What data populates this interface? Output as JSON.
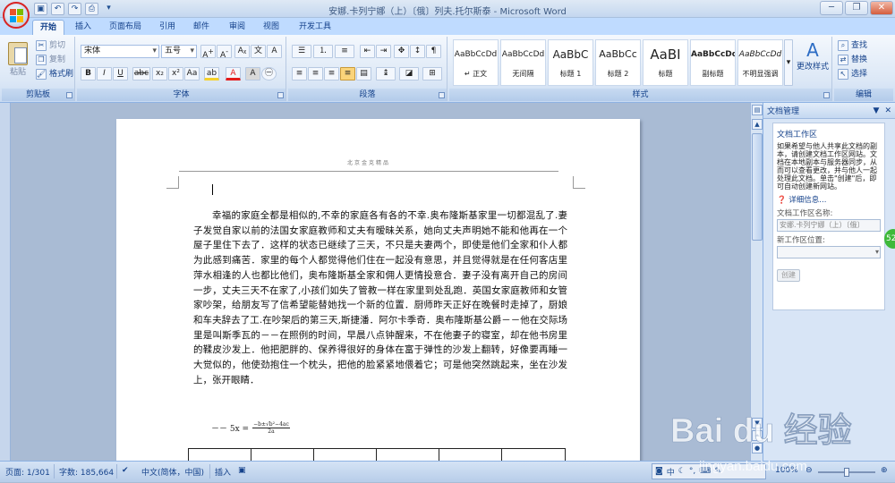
{
  "window": {
    "title": "安娜.卡列宁娜（上）〔俄〕列夫.托尔斯泰 - Microsoft Word",
    "qat": [
      "save-icon",
      "undo-icon",
      "redo-icon",
      "print-preview-icon"
    ]
  },
  "tabs": [
    "开始",
    "插入",
    "页面布局",
    "引用",
    "邮件",
    "审阅",
    "视图",
    "开发工具"
  ],
  "ribbon": {
    "clipboard": {
      "label": "剪贴板",
      "paste": "粘贴",
      "cut": "剪切",
      "copy": "复制",
      "format_painter": "格式刷"
    },
    "font": {
      "label": "字体",
      "font_name": "宋体",
      "font_size": "五号"
    },
    "paragraph": {
      "label": "段落"
    },
    "styles": {
      "label": "样式",
      "items": [
        {
          "sample": "AaBbCcDd",
          "name": "↵ 正文"
        },
        {
          "sample": "AaBbCcDd",
          "name": "无间隔"
        },
        {
          "sample": "AaBbC",
          "name": "标题 1"
        },
        {
          "sample": "AaBbCc",
          "name": "标题 2"
        },
        {
          "sample": "AaBI",
          "name": "标题"
        },
        {
          "sample": "AaBbCcDd",
          "name": "副标题"
        },
        {
          "sample": "AaBbCcDd",
          "name": "不明显强调"
        }
      ],
      "change_styles": "更改样式"
    },
    "editing": {
      "label": "编辑",
      "find": "查找",
      "replace": "替换",
      "select": "选择"
    }
  },
  "document": {
    "header_text": "北京金克精品",
    "body": "幸福的家庭全都是相似的,不幸的家庭各有各的不幸.奥布隆斯基家里一切都混乱了.妻子发觉自家以前的法国女家庭教师和丈夫有暧昧关系，她向丈夫声明她不能和他再在一个屋子里住下去了．这样的状态已继续了三天，不只是夫妻两个，即使是他们全家和仆人都为此感到痛苦．家里的每个人都觉得他们住在一起没有意思，并且觉得就是在任何客店里萍水相逢的人也都比他们，奥布隆斯基全家和佣人更情投意合．妻子没有离开自己的房间一步，丈夫三天不在家了,小孩们如失了管教一样在家里到处乱跑．英国女家庭教师和女管家吵架，给朋友写了信希望能替她找一个新的位置．厨师昨天正好在晚餐时走掉了，厨娘和车夫辞去了工.在吵架后的第三天,斯捷潘．阿尔卡季奇．奥布隆斯基公爵－－他在交际场里是叫斯季瓦的－－在照例的时间，早晨八点钟醒来，不在他妻子的寝室，却在他书房里的鞣皮沙发上．他把肥胖的、保养得很好的身体在富于弹性的沙发上翻转，好像要再睡一大觉似的，他使劲抱住一个枕头，把他的脸紧紧地偎着它；可是他突然跳起来，坐在沙发上，张开眼睛．",
    "formula_prefix": "－－  5x =",
    "formula_num": "−b±√b²−4ac",
    "formula_den": "2a"
  },
  "pane": {
    "title": "文档管理",
    "section": "文档工作区",
    "description": "如果希望与他人共享此文档的副本，请创建文档工作区网站。文档在本地副本与服务器同步，从而可以查看更改，并与他人一起处理此文档。单击\"创建\"后，即可自动创建新网站。",
    "info_link": "详细信息...",
    "name_label": "文档工作区名称:",
    "name_value": "安娜.卡列宁娜（上）〔俄〕",
    "location_label": "新工作区位置:",
    "create_label": "创建"
  },
  "status": {
    "page": "页面: 1/301",
    "words": "字数: 185,664",
    "language": "中文(简体，中国)",
    "insert": "插入",
    "zoom": "100%",
    "ime": "中"
  },
  "watermark": {
    "text": "Bai du 经验",
    "url": "jingyan.baidu.com"
  },
  "colors": {
    "accent": "#15428b",
    "highlight": "#f5d12b",
    "font_color": "#e41b1b",
    "orb_ring": "#d92323"
  }
}
